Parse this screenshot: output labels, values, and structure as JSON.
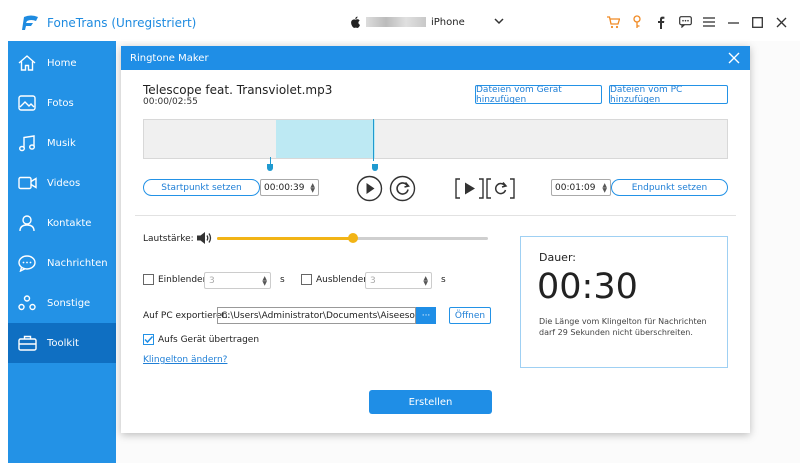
{
  "app": {
    "title": "FoneTrans (Unregistriert)",
    "device": "iPhone"
  },
  "sidebar": {
    "items": [
      {
        "label": "Home",
        "icon": "home-icon"
      },
      {
        "label": "Fotos",
        "icon": "photos-icon"
      },
      {
        "label": "Musik",
        "icon": "music-icon"
      },
      {
        "label": "Videos",
        "icon": "videos-icon"
      },
      {
        "label": "Kontakte",
        "icon": "contacts-icon"
      },
      {
        "label": "Nachrichten",
        "icon": "messages-icon"
      },
      {
        "label": "Sonstige",
        "icon": "other-icon"
      },
      {
        "label": "Toolkit",
        "icon": "toolkit-icon",
        "active": true
      }
    ]
  },
  "modal": {
    "title": "Ringtone Maker",
    "file_name": "Telescope feat. Transviolet.mp3",
    "file_time": "00:00/02:55",
    "add_from_device": "Dateien vom Gerät hinzufügen",
    "add_from_pc": "Dateien vom PC hinzufügen",
    "set_start": "Startpunkt setzen",
    "start_time": "00:00:39",
    "end_time": "00:01:09",
    "set_end": "Endpunkt setzen",
    "volume_label": "Lautstärke:",
    "volume_level": 0.5,
    "fade_in_label": "Einblenden",
    "fade_in_value": "3",
    "fade_out_label": "Ausblenden",
    "fade_out_value": "3",
    "seconds_unit": "s",
    "export_label": "Auf PC exportieren:",
    "export_path": "C:\\Users\\Administrator\\Documents\\Aiseesoft Stud",
    "browse_label": "···",
    "open_label": "Öffnen",
    "transfer_label": "Aufs Gerät übertragen",
    "transfer_checked": true,
    "change_ringtone_link": "Klingelton ändern?",
    "duration_label": "Dauer:",
    "duration_value": "00:30",
    "duration_note": "Die Länge vom Klingelton für Nachrichten darf 29 Sekunden nicht überschreiten.",
    "create_label": "Erstellen"
  },
  "colors": {
    "accent": "#2392e6",
    "active_nav": "#0f6fc2",
    "volume": "#f2b416",
    "selection": "#bde9f3"
  }
}
